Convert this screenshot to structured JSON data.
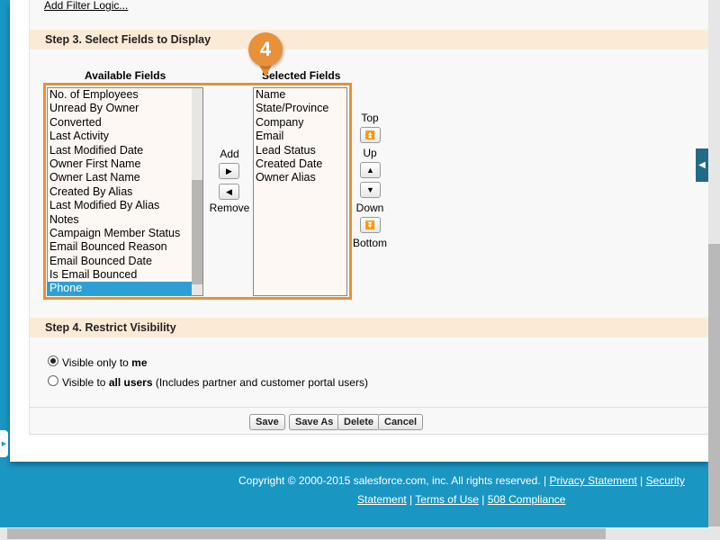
{
  "filter_link": "Add Filter Logic...",
  "step3": {
    "title": "Step 3. Select Fields to Display",
    "available_label": "Available Fields",
    "selected_label": "Selected Fields",
    "available": [
      "No. of Employees",
      "Unread By Owner",
      "Converted",
      "Last Activity",
      "Last Modified Date",
      "Owner First Name",
      "Owner Last Name",
      "Created By Alias",
      "Last Modified By Alias",
      "Notes",
      "Campaign Member Status",
      "Email Bounced Reason",
      "Email Bounced Date",
      "Is Email Bounced",
      "Phone"
    ],
    "available_selected": "Phone",
    "selected": [
      "Name",
      "State/Province",
      "Company",
      "Email",
      "Lead Status",
      "Created Date",
      "Owner Alias"
    ],
    "add": "Add",
    "remove": "Remove",
    "top": "Top",
    "up": "Up",
    "down": "Down",
    "bottom": "Bottom"
  },
  "badge": "4",
  "step4": {
    "title": "Step 4. Restrict Visibility",
    "opt1_pre": "Visible only to ",
    "opt1_bold": "me",
    "opt2_pre": "Visible to ",
    "opt2_bold": "all users",
    "opt2_post": " (Includes partner and customer portal users)",
    "selected": "opt1"
  },
  "buttons": {
    "save": "Save",
    "save_as": "Save As",
    "delete": "Delete",
    "cancel": "Cancel"
  },
  "footer": {
    "copyright": "Copyright © 2000-2015 salesforce.com, inc. All rights reserved. |",
    "privacy": "Privacy Statement",
    "security": "Security Statement",
    "terms": "Terms of Use",
    "compliance": "508 Compliance"
  },
  "colors": {
    "accent": "#e8903a",
    "background": "#1a96c2",
    "section": "#fbebd6",
    "selection": "#2e9fd4"
  }
}
